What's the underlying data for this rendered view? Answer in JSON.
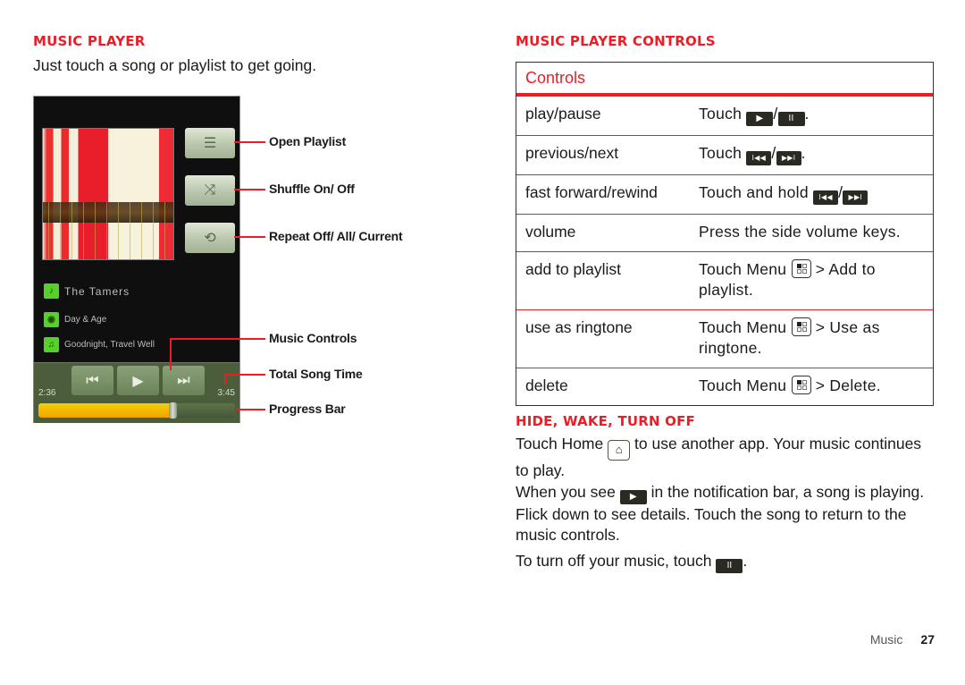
{
  "left": {
    "heading": "MUSIC PLAYER",
    "intro": "Just touch a song or playlist to get going.",
    "player": {
      "side_buttons": [
        {
          "icon": "playlist-icon",
          "glyph": "☰"
        },
        {
          "icon": "shuffle-icon",
          "glyph": "⤨"
        },
        {
          "icon": "repeat-icon",
          "glyph": "⟲"
        }
      ],
      "artist": "The Tamers",
      "album": "Day & Age",
      "song": "Goodnight, Travel Well",
      "elapsed": "2:36",
      "total": "3:45",
      "progress_fraction": 0.68,
      "controls": {
        "prev": "⏮",
        "play": "▶",
        "next": "⏭"
      }
    },
    "callouts": {
      "open_playlist": "Open Playlist",
      "shuffle": "Shuffle On/ Off",
      "repeat": "Repeat Off/ All/ Current",
      "music_controls": "Music Controls",
      "total_song_time": "Total Song Time",
      "progress_bar": "Progress Bar"
    }
  },
  "right": {
    "heading": "MUSIC PLAYER CONTROLS",
    "table": {
      "header": "Controls",
      "rows": [
        {
          "action": "play/pause",
          "pre": "Touch",
          "post": "."
        },
        {
          "action": "previous/next",
          "pre": "Touch",
          "post": "."
        },
        {
          "action": "fast forward/rewind",
          "pre": "Touch and hold",
          "post": ""
        },
        {
          "action": "volume",
          "text": "Press the side volume keys."
        },
        {
          "action": "add to playlist",
          "pre": "Touch Menu",
          "post": "> Add to playlist."
        },
        {
          "action": "use as ringtone",
          "pre": "Touch Menu",
          "post": "> Use as ringtone."
        },
        {
          "action": "delete",
          "pre": "Touch Menu",
          "post": "> Delete."
        }
      ],
      "keys": {
        "play": "▶",
        "pause": "II",
        "prev": "I◀◀",
        "next": "▶▶I",
        "slash": "/"
      }
    },
    "hide_heading": "HIDE, WAKE, TURN OFF",
    "p1_pre": "Touch Home",
    "p1_post": "to use another app. Your music continues to play.",
    "p2_pre": "When you see",
    "p2_post": "in the notification bar, a song is playing. Flick down to see details. Touch the song to return to the music controls.",
    "p3_pre": "To turn off your music, touch",
    "p3_post": ".",
    "home_glyph": "⌂"
  },
  "footer": {
    "section": "Music",
    "page": "27"
  },
  "colors": {
    "accent": "#ee1c25",
    "progress": "#f4c200",
    "player_bg": "#0f0f0f"
  }
}
